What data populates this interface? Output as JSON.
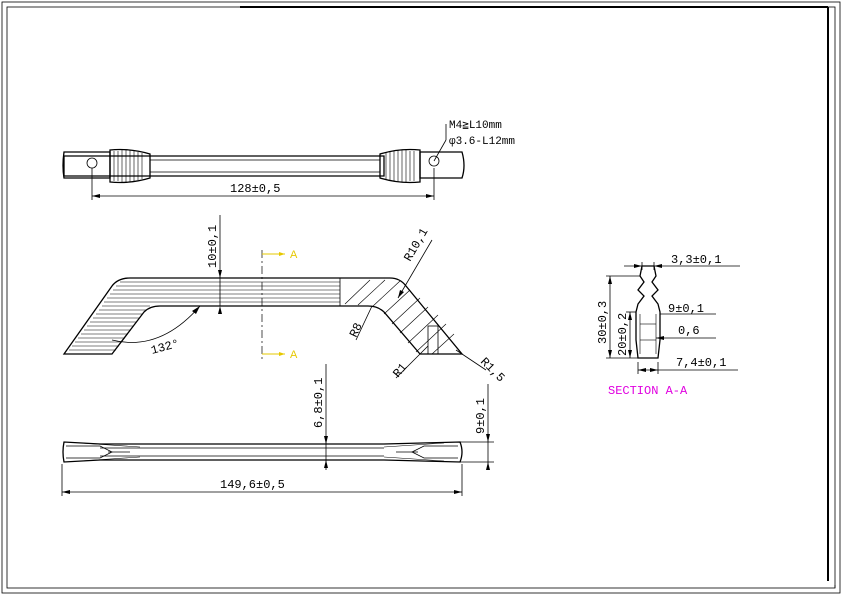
{
  "drawing": {
    "top_view": {
      "thread_note": "M4≧L10mm",
      "hole_note": "φ3.6-L12mm",
      "length_dim": "128±0,5"
    },
    "side_view": {
      "height_dim": "10±0,1",
      "angle": "132°",
      "radius_large": "R10,1",
      "radius_r8": "R8",
      "radius_r1": "R1",
      "radius_r15": "R1,5",
      "section_label_a": "A"
    },
    "bottom_view": {
      "thickness_dim": "6,8±0,1",
      "end_height_dim": "9±0,1",
      "overall_length_dim": "149,6±0,5"
    },
    "section": {
      "title": "SECTION A-A",
      "top_width": "3,3±0,1",
      "overall_height": "30±0,3",
      "inner_height": "20±0,2",
      "mid_width": "9±0,1",
      "wall": "0,6",
      "base_width": "7,4±0,1"
    }
  },
  "colors": {
    "section_title": "#e000e0",
    "cut_marker": "#e6c800"
  }
}
